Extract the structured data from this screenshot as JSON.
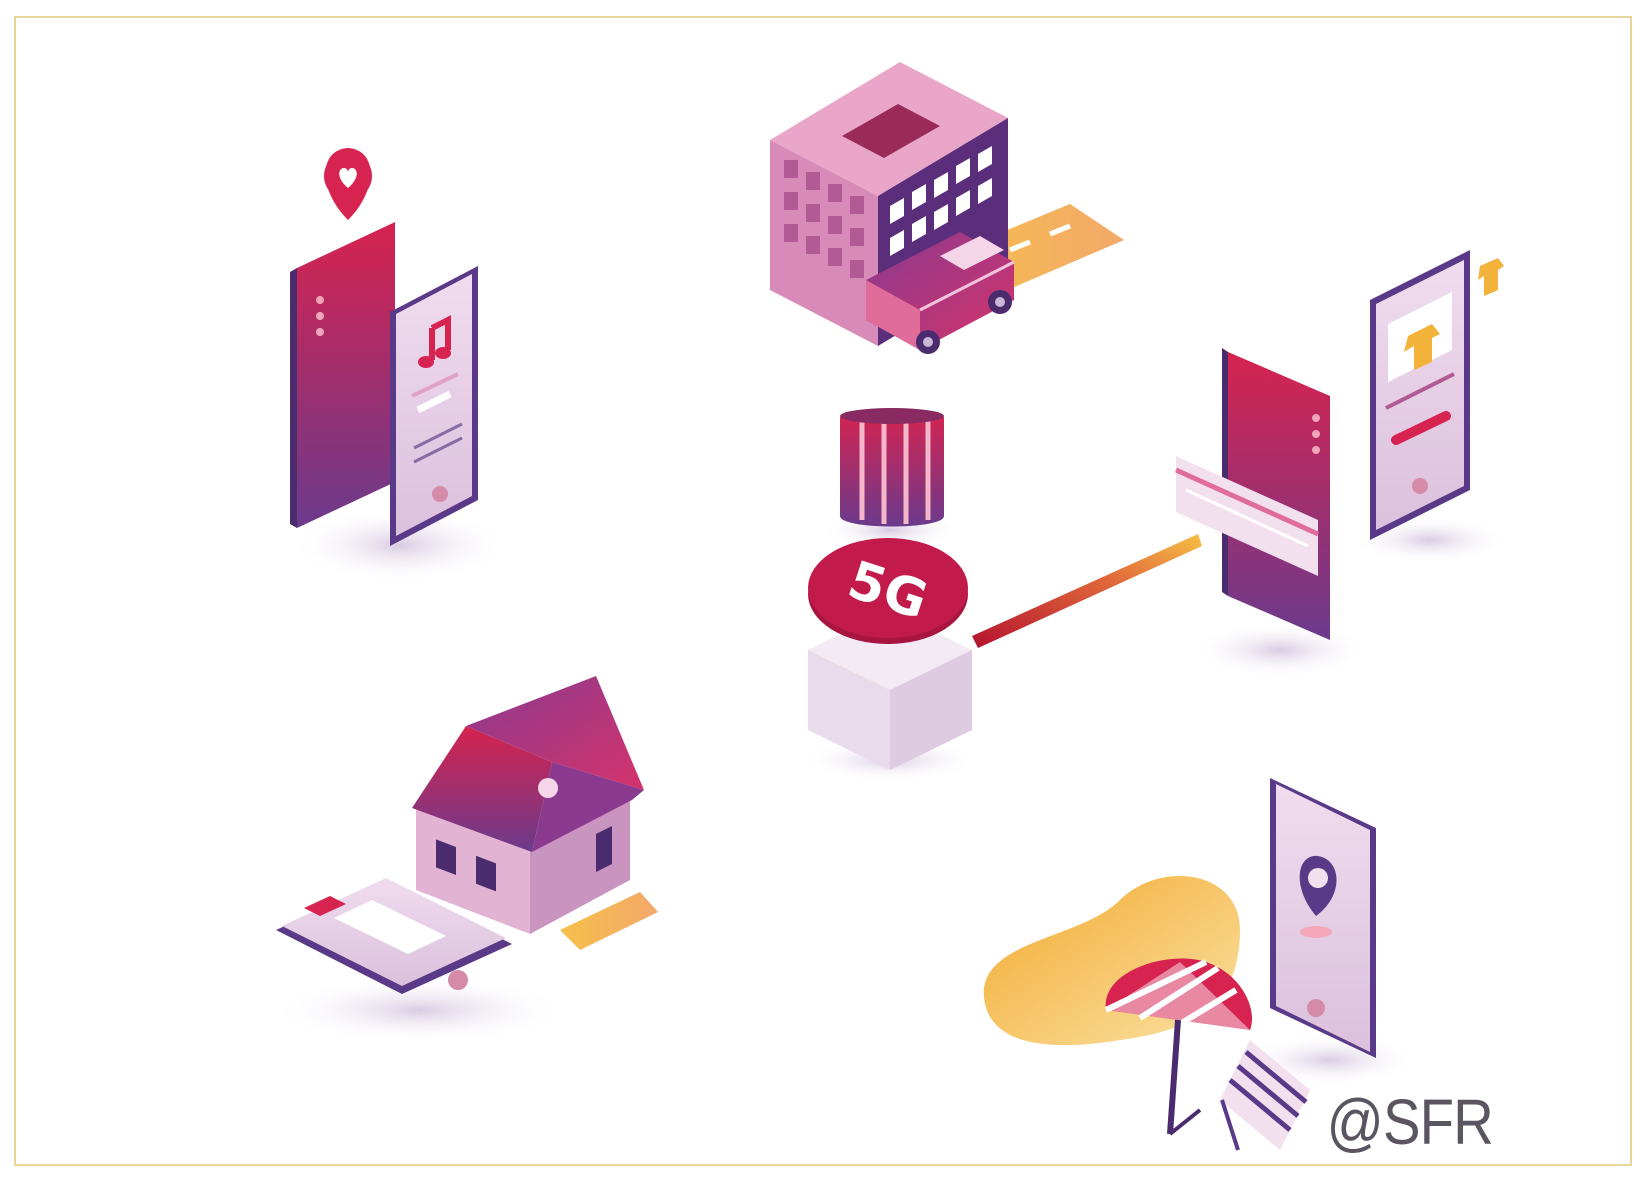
{
  "illustration": {
    "badge_text": "5G",
    "credit_text": "@SFR",
    "colors": {
      "crimson": "#d6234f",
      "purple": "#6b3a8c",
      "lilac": "#e7cfe6",
      "pink": "#c77ab2",
      "amber": "#f3b23a",
      "frame": "#e8d59a"
    },
    "icons": [
      "music-phones-icon",
      "heart-location-pin-icon",
      "office-building-icon",
      "delivery-van-icon",
      "road-icon",
      "5g-antenna-icon",
      "5g-badge-icon",
      "signal-beam-icon",
      "shopping-phone-icon",
      "payment-card-icon",
      "smart-home-icon",
      "streaming-tablet-icon",
      "beach-umbrella-icon",
      "deck-chair-icon",
      "location-phone-icon"
    ]
  }
}
